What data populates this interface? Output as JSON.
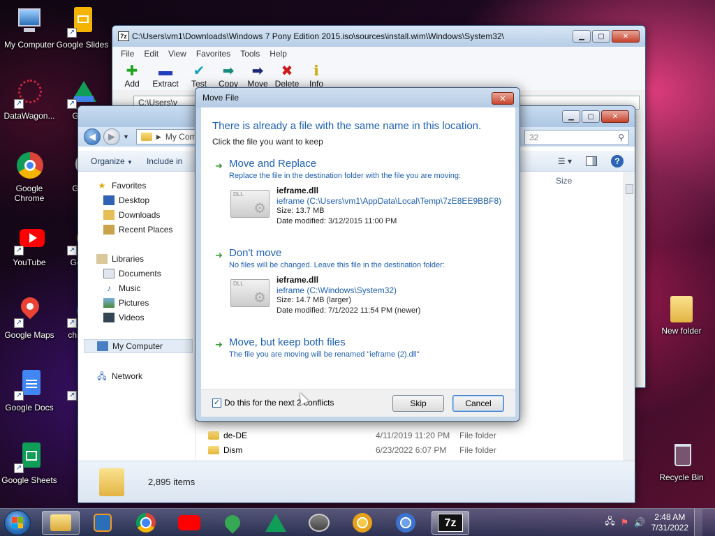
{
  "desktop": {
    "icons": [
      {
        "label": "My Computer"
      },
      {
        "label": "Google Slides"
      },
      {
        "label": "DataWagon..."
      },
      {
        "label": "Goog"
      },
      {
        "label": "Google Chrome"
      },
      {
        "label": "Goog"
      },
      {
        "label": "YouTube"
      },
      {
        "label": "Go Ch"
      },
      {
        "label": "Google Maps"
      },
      {
        "label": "chr Sho"
      },
      {
        "label": "Google Docs"
      },
      {
        "label": "Sh"
      },
      {
        "label": "Google Sheets"
      },
      {
        "label": "New folder"
      },
      {
        "label": "Recycle Bin"
      }
    ]
  },
  "zip_window": {
    "title": "C:\\Users\\vm1\\Downloads\\Windows 7 Pony Edition 2015.iso\\sources\\install.wim\\Windows\\System32\\",
    "menu": [
      "File",
      "Edit",
      "View",
      "Favorites",
      "Tools",
      "Help"
    ],
    "toolbar": [
      {
        "label": "Add",
        "icon": "plus-icon",
        "color": "#1fa51f"
      },
      {
        "label": "Extract",
        "icon": "minus-icon",
        "color": "#1f3fbf"
      },
      {
        "label": "Test",
        "icon": "check-icon",
        "color": "#12a6b8"
      },
      {
        "label": "Copy",
        "icon": "double-arrow-icon",
        "color": "#138a7a"
      },
      {
        "label": "Move",
        "icon": "arrow-right-icon",
        "color": "#1c2a7a"
      },
      {
        "label": "Delete",
        "icon": "x-icon",
        "color": "#d01818"
      },
      {
        "label": "Info",
        "icon": "info-icon",
        "color": "#c9a800"
      }
    ],
    "address": "C:\\Users\\v"
  },
  "explorer": {
    "address_label": "My Comp",
    "search_placeholder": "32",
    "commands": {
      "organize": "Organize",
      "include": "Include in"
    },
    "nav": {
      "favorites": "Favorites",
      "desktop": "Desktop",
      "downloads": "Downloads",
      "recent": "Recent Places",
      "libraries": "Libraries",
      "documents": "Documents",
      "music": "Music",
      "pictures": "Pictures",
      "videos": "Videos",
      "computer": "My Computer",
      "network": "Network"
    },
    "column_size": "Size",
    "rows": [
      {
        "name": "de-DE",
        "date": "4/11/2019 11:20 PM",
        "type": "File folder"
      },
      {
        "name": "Dism",
        "date": "6/23/2022 6:07 PM",
        "type": "File folder"
      }
    ],
    "status_count": "2,895 items"
  },
  "dialog": {
    "title": "Move File",
    "heading": "There is already a file with the same name in this location.",
    "subheading": "Click the file you want to keep",
    "options": {
      "replace": {
        "title": "Move and Replace",
        "desc": "Replace the file in the destination folder with the file you are moving:",
        "file_name": "ieframe.dll",
        "file_path": "ieframe (C:\\Users\\vm1\\AppData\\Local\\Temp\\7zE8EE9BBF8)",
        "size": "Size: 13.7 MB",
        "date": "Date modified: 3/12/2015 11:00 PM"
      },
      "dont_move": {
        "title": "Don't move",
        "desc": "No files will be changed. Leave this file in the destination folder:",
        "file_name": "ieframe.dll",
        "file_path": "ieframe (C:\\Windows\\System32)",
        "size": "Size: 14.7 MB (larger)",
        "date": "Date modified: 7/1/2022 11:54 PM (newer)"
      },
      "keep_both": {
        "title": "Move, but keep both files",
        "desc": "The file you are moving will be renamed \"ieframe (2).dll\""
      }
    },
    "checkbox_label": "Do this for the next 2 conflicts",
    "checkbox_checked": true,
    "skip": "Skip",
    "cancel": "Cancel"
  },
  "taskbar": {
    "apps": [
      "file-explorer",
      "media-player",
      "chrome",
      "youtube",
      "google-maps",
      "google-drive",
      "google-earth-pro",
      "chrome-canary",
      "chromium",
      "7zip"
    ],
    "time": "2:48 AM",
    "date": "7/31/2022"
  },
  "colors": {
    "accent": "#1e5fb3",
    "option_arrow": "#3a9a3a"
  }
}
